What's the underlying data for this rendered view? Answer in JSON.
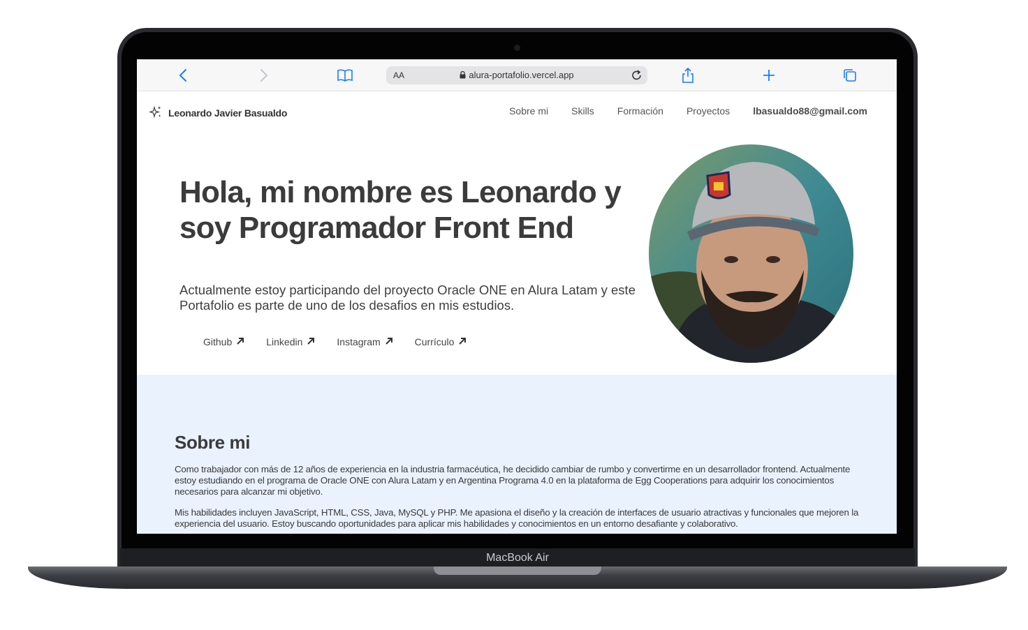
{
  "device": {
    "label": "MacBook Air"
  },
  "browser": {
    "address_prefix": "AA",
    "url": "alura-portafolio.vercel.app"
  },
  "site": {
    "brand": "Leonardo Javier Basualdo",
    "nav": [
      "Sobre mi",
      "Skills",
      "Formación",
      "Proyectos"
    ],
    "email": "lbasualdo88@gmail.com"
  },
  "hero": {
    "title": "Hola, mi nombre es Leonardo y soy Programador Front End",
    "text": "Actualmente estoy participando del proyecto Oracle ONE en Alura Latam y este Portafolio es parte de uno de los desafios en mis estudios.",
    "links": [
      "Github",
      "Linkedin",
      "Instagram",
      "Currículo"
    ]
  },
  "about": {
    "title": "Sobre mi",
    "p1": "Como trabajador con más de 12 años de experiencia en la industria farmacéutica, he decidido cambiar de rumbo y convertirme en un desarrollador frontend. Actualmente estoy estudiando en el programa de Oracle ONE con Alura Latam y en Argentina Programa 4.0 en la plataforma de Egg Cooperations para adquirir los conocimientos necesarios para alcanzar mi objetivo.",
    "p2": "Mis habilidades incluyen JavaScript, HTML, CSS, Java, MySQL y PHP. Me apasiona el diseño y la creación de interfaces de usuario atractivas y funcionales que mejoren la experiencia del usuario. Estoy buscando oportunidades para aplicar mis habilidades y conocimientos en un entorno desafiante y colaborativo."
  },
  "colors": {
    "accent": "#1a7cf5",
    "about_bg": "#e9f2fd",
    "text": "#3b3b3b"
  }
}
